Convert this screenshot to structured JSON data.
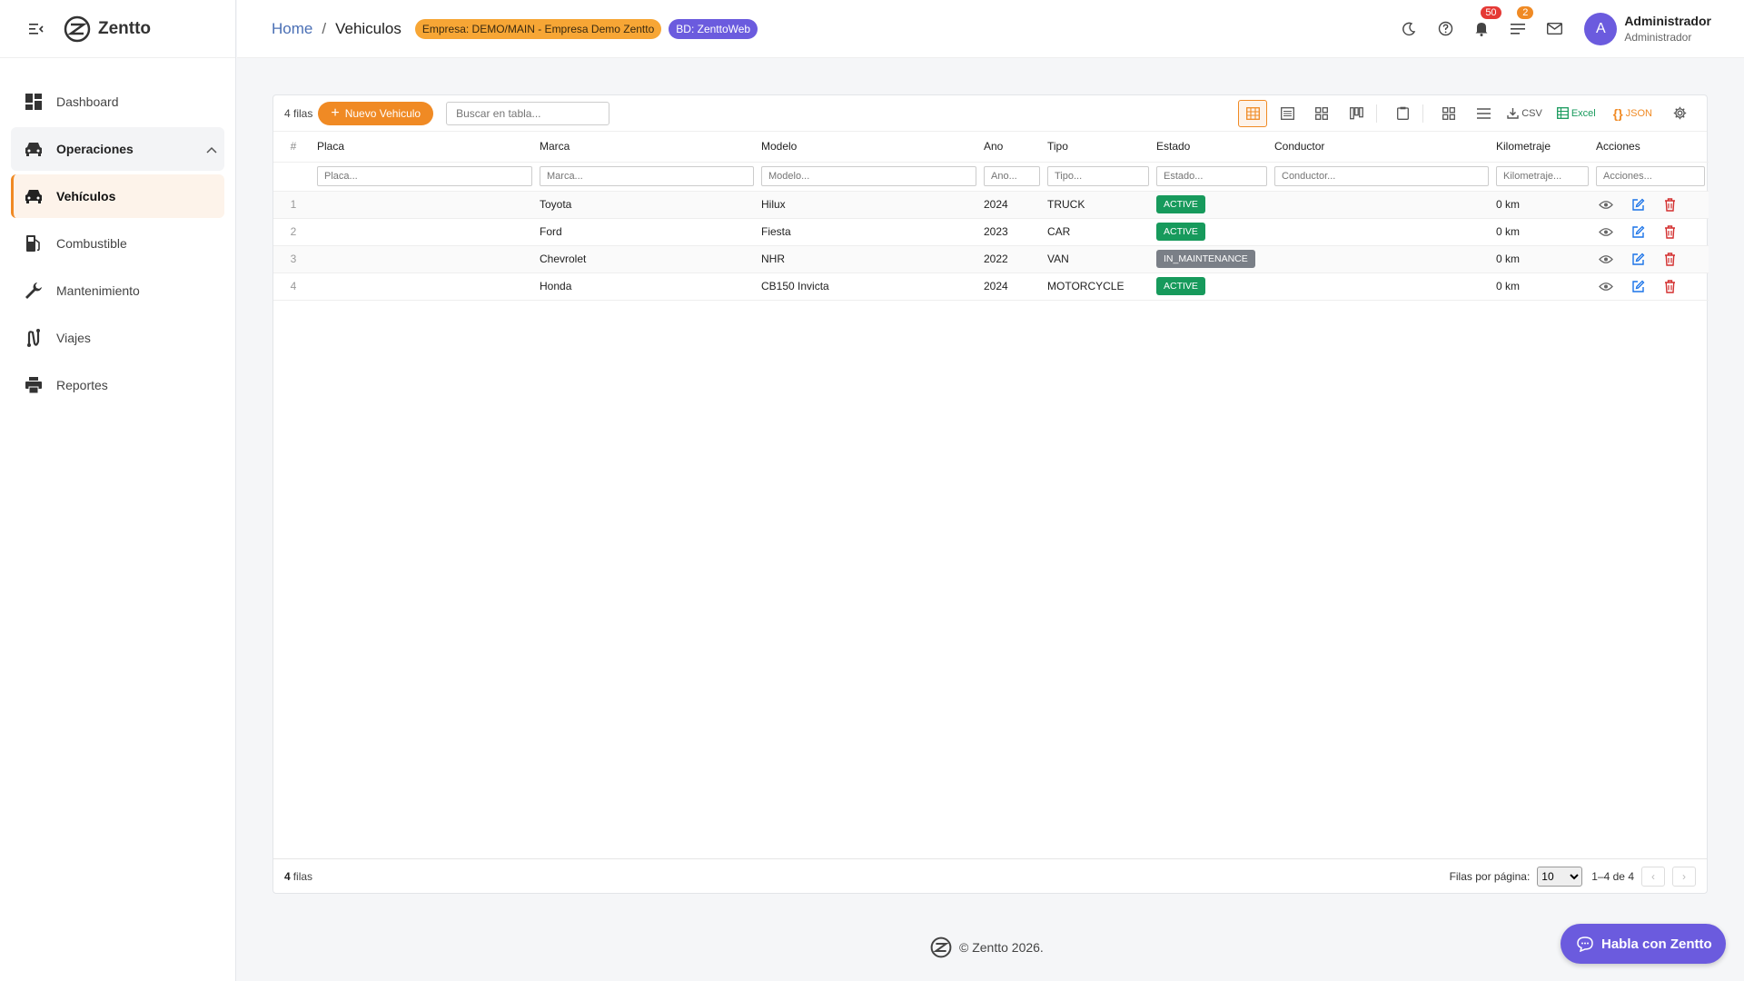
{
  "app": {
    "name": "Zentto"
  },
  "sidebar": {
    "items": [
      {
        "label": "Dashboard"
      },
      {
        "label": "Operaciones"
      },
      {
        "label": "Vehículos"
      },
      {
        "label": "Combustible"
      },
      {
        "label": "Mantenimiento"
      },
      {
        "label": "Viajes"
      },
      {
        "label": "Reportes"
      }
    ]
  },
  "header": {
    "breadcrumb_home": "Home",
    "breadcrumb_sep": "/",
    "breadcrumb_current": "Vehiculos",
    "empresa_badge": "Empresa: DEMO/MAIN - Empresa Demo Zentto",
    "bd_badge": "BD: ZenttoWeb",
    "notifications_count": "50",
    "tasks_count": "2",
    "avatar_letter": "A",
    "user_name": "Administrador",
    "user_role": "Administrador"
  },
  "toolbar": {
    "rows_label": "4 filas",
    "new_button": "Nuevo Vehiculo",
    "search_placeholder": "Buscar en tabla...",
    "csv_label": "CSV",
    "excel_label": "Excel",
    "json_label": "JSON"
  },
  "table": {
    "columns": [
      "#",
      "Placa",
      "Marca",
      "Modelo",
      "Ano",
      "Tipo",
      "Estado",
      "Conductor",
      "Kilometraje",
      "Acciones"
    ],
    "filters": [
      "Placa...",
      "Marca...",
      "Modelo...",
      "Ano...",
      "Tipo...",
      "Estado...",
      "Conductor...",
      "Kilometraje...",
      "Acciones..."
    ],
    "rows": [
      {
        "n": "1",
        "placa": "",
        "marca": "Toyota",
        "modelo": "Hilux",
        "ano": "2024",
        "tipo": "TRUCK",
        "estado": "ACTIVE",
        "conductor": "",
        "km": "0 km"
      },
      {
        "n": "2",
        "placa": "",
        "marca": "Ford",
        "modelo": "Fiesta",
        "ano": "2023",
        "tipo": "CAR",
        "estado": "ACTIVE",
        "conductor": "",
        "km": "0 km"
      },
      {
        "n": "3",
        "placa": "",
        "marca": "Chevrolet",
        "modelo": "NHR",
        "ano": "2022",
        "tipo": "VAN",
        "estado": "IN_MAINTENANCE",
        "conductor": "",
        "km": "0 km"
      },
      {
        "n": "4",
        "placa": "",
        "marca": "Honda",
        "modelo": "CB150 Invicta",
        "ano": "2024",
        "tipo": "MOTORCYCLE",
        "estado": "ACTIVE",
        "conductor": "",
        "km": "0 km"
      }
    ]
  },
  "footer": {
    "rows_count": "4",
    "rows_word": "filas",
    "per_page_label": "Filas por página:",
    "per_page_value": "10",
    "range": "1–4 de 4"
  },
  "copyright": "© Zentto 2026.",
  "chat_button": "Habla con Zentto",
  "colors": {
    "accent": "#f08a24",
    "brand": "#6b5bde",
    "active": "#179a5c",
    "maintenance": "#7a7f87",
    "danger": "#d32f2f"
  }
}
